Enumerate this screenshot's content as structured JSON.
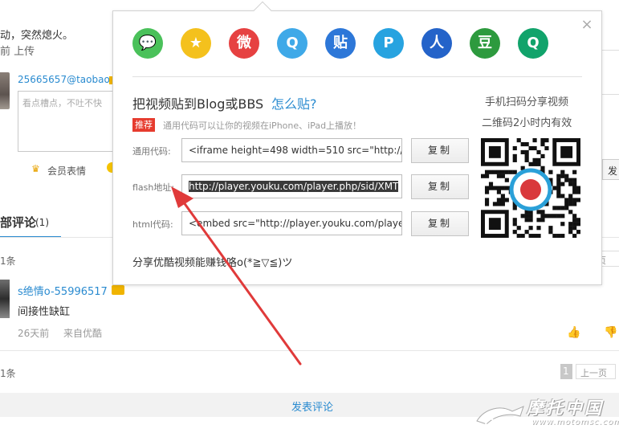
{
  "background": {
    "description_line1": "动，突然熄火。",
    "description_line2": "前 上传",
    "comment_user": "25665657@taobao",
    "comment_placeholder": "看点槽点，不吐不快",
    "vip_emoji_label": "会员表情",
    "post_button_partial": "发",
    "section_title": "部评论",
    "section_count": "(1)",
    "count_top": "1条",
    "pager_top": "页",
    "commenter": "s绝情o-55996517",
    "comment_text": "间接性缺缸",
    "comment_time": "26天前",
    "comment_source": "来自优酷",
    "count_bottom": "1条",
    "current_page": "1",
    "prev_page": "上一页",
    "post_comment": "发表评论"
  },
  "popup": {
    "share_icons": [
      {
        "name": "wechat-icon",
        "color": "#4ac15a",
        "glyph": "💬"
      },
      {
        "name": "qzone-icon",
        "color": "#f4c11d",
        "glyph": "★"
      },
      {
        "name": "weibo-icon",
        "color": "#e64141",
        "glyph": "微"
      },
      {
        "name": "qq-icon",
        "color": "#3fa9e8",
        "glyph": "Q"
      },
      {
        "name": "tieba-icon",
        "color": "#2d77d8",
        "glyph": "贴"
      },
      {
        "name": "pengyou-icon",
        "color": "#27a3e0",
        "glyph": "P"
      },
      {
        "name": "renren-icon",
        "color": "#2463c9",
        "glyph": "人"
      },
      {
        "name": "douban-icon",
        "color": "#2d9a3e",
        "glyph": "豆"
      },
      {
        "name": "qq-weibo-icon",
        "color": "#11a36b",
        "glyph": "Q"
      }
    ],
    "close_glyph": "×",
    "blog_title": "把视频贴到Blog或BBS",
    "how_link": "怎么贴?",
    "recommend_tag": "推荐",
    "recommend_note": "通用代码可以让你的视频在iPhone、iPad上播放！",
    "fields": {
      "general": {
        "label": "通用代码:",
        "value": "<iframe height=498 width=510 src=\"http://p"
      },
      "flash": {
        "label": "flash地址:",
        "value": "http://player.youku.com/player.php/sid/XMT"
      },
      "html": {
        "label": "html代码:",
        "value": "<embed src=\"http://player.youku.com/playe"
      }
    },
    "copy_label": "复制",
    "bottom_note": "分享优酷视频能赚钱咯o(*≧▽≦)ツ",
    "qr_title1": "手机扫码分享视频",
    "qr_title2": "二维码2小时内有效"
  },
  "watermark": {
    "text": "摩托中国",
    "sub": "www.motomsc.com"
  },
  "colors": {
    "link_blue": "#2a8bd0",
    "arrow_red": "#e03a3a",
    "recommend_red": "#e63b2e"
  }
}
